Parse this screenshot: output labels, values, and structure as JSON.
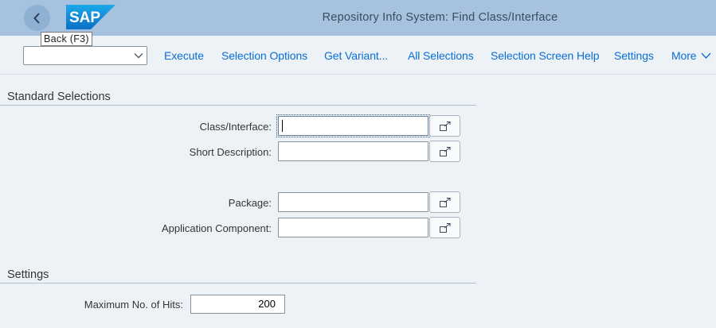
{
  "header": {
    "title": "Repository Info System: Find Class/Interface",
    "logo_text": "SAP",
    "back_tooltip": "Back  (F3)"
  },
  "toolbar": {
    "variant_value": "",
    "execute": "Execute",
    "selection_options": "Selection Options",
    "get_variant": "Get Variant...",
    "all_selections": "All Selections",
    "selection_screen_help": "Selection Screen Help",
    "settings": "Settings",
    "more": "More"
  },
  "standard_selections": {
    "title": "Standard Selections",
    "fields": [
      {
        "label": "Class/Interface:",
        "value": ""
      },
      {
        "label": "Short Description:",
        "value": ""
      },
      {
        "label": "Package:",
        "value": ""
      },
      {
        "label": "Application Component:",
        "value": ""
      }
    ]
  },
  "settings_section": {
    "title": "Settings",
    "max_hits_label": "Maximum No. of Hits:",
    "max_hits_value": "200"
  },
  "colors": {
    "header_bg": "#a6c2df",
    "page_bg": "#edf2f7",
    "link": "#0a6ed1"
  }
}
